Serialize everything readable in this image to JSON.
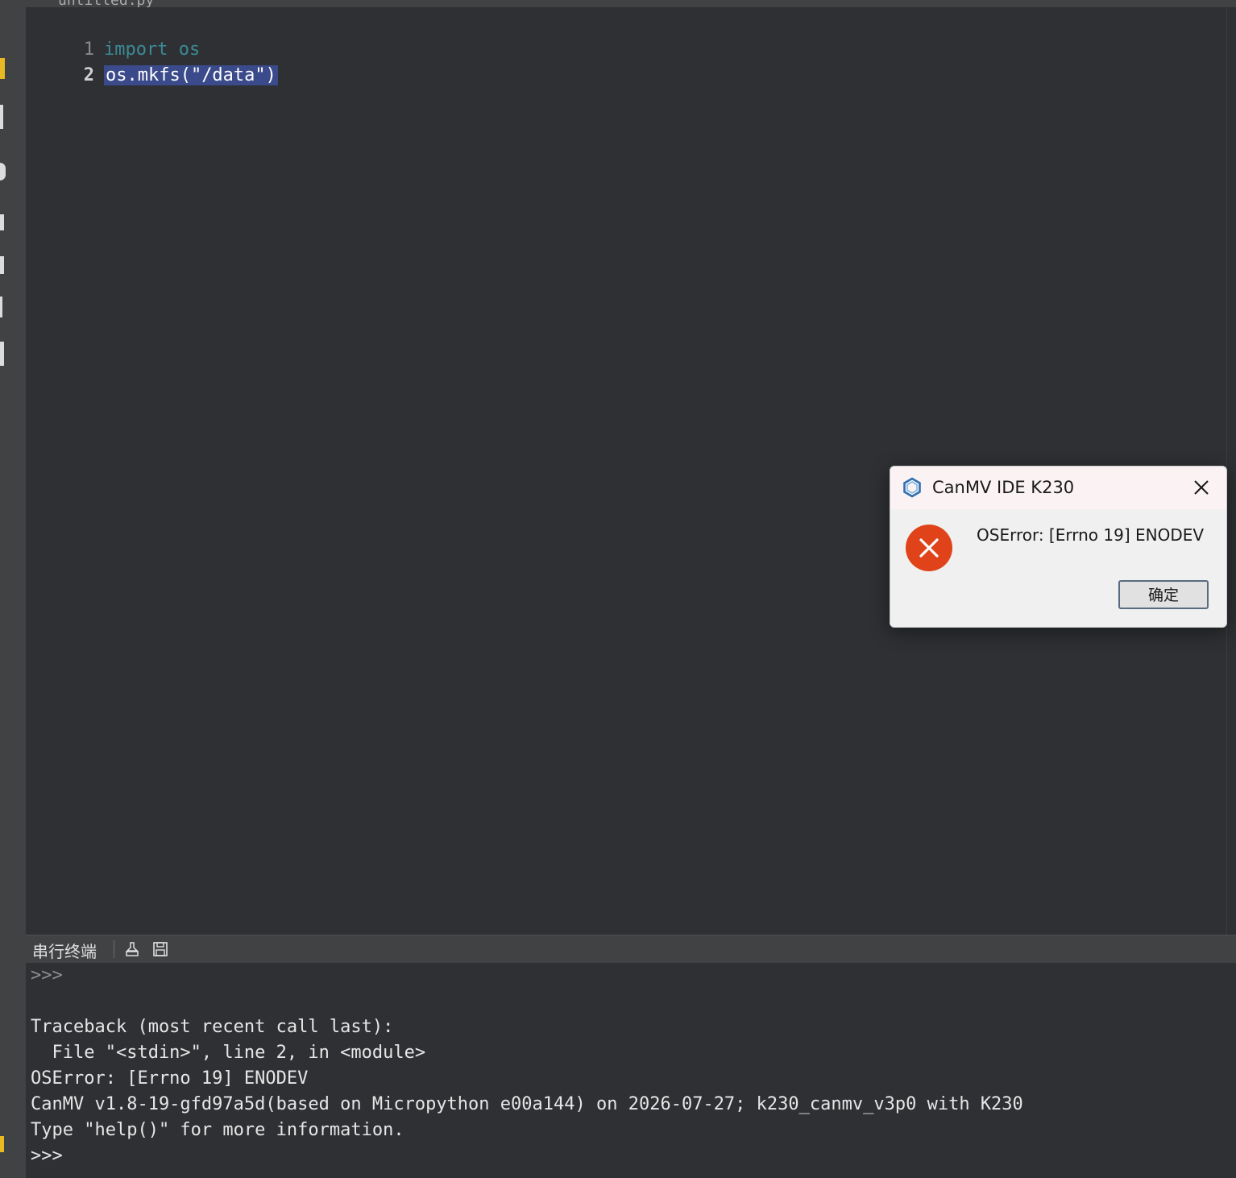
{
  "tab": {
    "label": "untitled.py"
  },
  "editor": {
    "lines": [
      {
        "num": "1",
        "keyword": "import",
        "rest": "os"
      },
      {
        "num": "2",
        "text": "os.mkfs(\"/data\")"
      }
    ]
  },
  "terminal": {
    "title": "串行终端",
    "clear_icon": "clear-icon",
    "save_icon": "save-icon",
    "lines": [
      ">>>",
      "",
      "Traceback (most recent call last):",
      "  File \"<stdin>\", line 2, in <module>",
      "OSError: [Errno 19] ENODEV",
      "CanMV v1.8-19-gfd97a5d(based on Micropython e00a144) on 2026-07-27; k230_canmv_v3p0 with K230",
      "Type \"help()\" for more information.",
      ">>>"
    ]
  },
  "dialog": {
    "title": "CanMV IDE K230",
    "message": "OSError: [Errno 19] ENODEV",
    "ok_label": "确定",
    "icon": "error-icon",
    "error_color": "#e0431a"
  }
}
